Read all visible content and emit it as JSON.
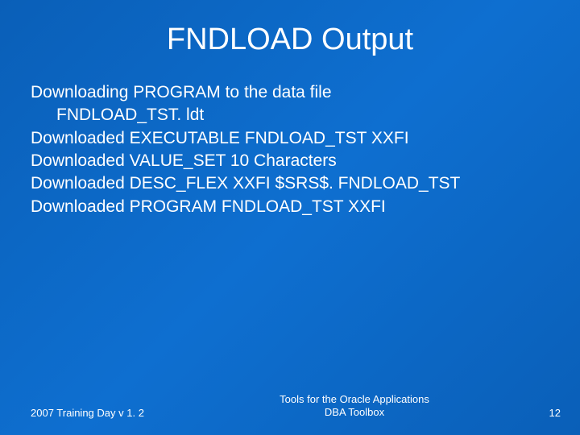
{
  "title": "FNDLOAD Output",
  "lines": {
    "l0": "Downloading PROGRAM to the data file",
    "l1": "FNDLOAD_TST. ldt",
    "l2": "Downloaded EXECUTABLE FNDLOAD_TST XXFI",
    "l3": "Downloaded VALUE_SET 10 Characters",
    "l4": "Downloaded DESC_FLEX XXFI $SRS$. FNDLOAD_TST",
    "l5": "Downloaded PROGRAM FNDLOAD_TST XXFI"
  },
  "footer": {
    "left": "2007 Training Day v 1. 2",
    "center_line1": "Tools for the Oracle Applications",
    "center_line2": "DBA Toolbox",
    "page": "12"
  }
}
